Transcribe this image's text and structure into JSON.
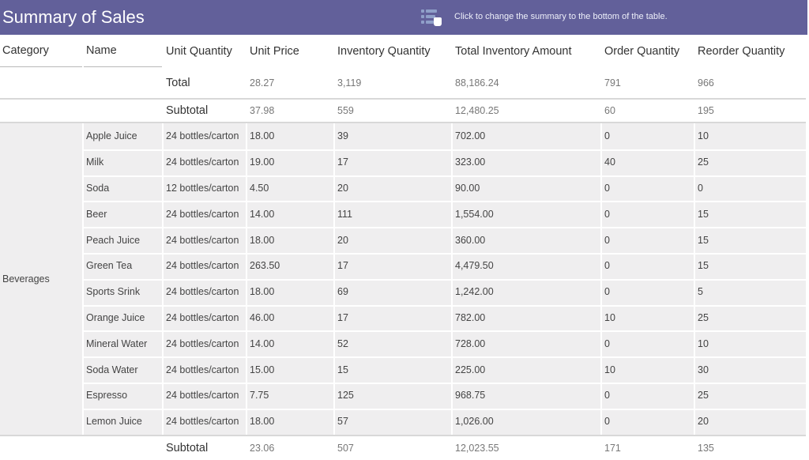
{
  "header": {
    "title": "Summary of Sales",
    "hint_icon": "summary-position-icon",
    "hint_text": "Click to change the summary to the bottom of the table."
  },
  "columns": [
    "Category",
    "Name",
    "Unit Quantity",
    "Unit Price",
    "Inventory Quantity",
    "Total Inventory Amount",
    "Order Quantity",
    "Reorder Quantity"
  ],
  "total": {
    "label": "Total",
    "unit_price": "28.27",
    "inventory_quantity": "3,119",
    "total_inventory_amount": "88,186.24",
    "order_quantity": "791",
    "reorder_quantity": "966"
  },
  "subtotal_top": {
    "label": "Subtotal",
    "unit_price": "37.98",
    "inventory_quantity": "559",
    "total_inventory_amount": "12,480.25",
    "order_quantity": "60",
    "reorder_quantity": "195"
  },
  "group": {
    "category": "Beverages",
    "rows": [
      {
        "name": "Apple Juice",
        "unit_quantity": "24 bottles/carton",
        "unit_price": "18.00",
        "inventory_quantity": "39",
        "total_inventory_amount": "702.00",
        "order_quantity": "0",
        "reorder_quantity": "10"
      },
      {
        "name": "Milk",
        "unit_quantity": "24 bottles/carton",
        "unit_price": "19.00",
        "inventory_quantity": "17",
        "total_inventory_amount": "323.00",
        "order_quantity": "40",
        "reorder_quantity": "25"
      },
      {
        "name": "Soda",
        "unit_quantity": "12 bottles/carton",
        "unit_price": "4.50",
        "inventory_quantity": "20",
        "total_inventory_amount": "90.00",
        "order_quantity": "0",
        "reorder_quantity": "0"
      },
      {
        "name": "Beer",
        "unit_quantity": "24 bottles/carton",
        "unit_price": "14.00",
        "inventory_quantity": "111",
        "total_inventory_amount": "1,554.00",
        "order_quantity": "0",
        "reorder_quantity": "15"
      },
      {
        "name": "Peach Juice",
        "unit_quantity": "24 bottles/carton",
        "unit_price": "18.00",
        "inventory_quantity": "20",
        "total_inventory_amount": "360.00",
        "order_quantity": "0",
        "reorder_quantity": "15"
      },
      {
        "name": "Green Tea",
        "unit_quantity": "24 bottles/carton",
        "unit_price": "263.50",
        "inventory_quantity": "17",
        "total_inventory_amount": "4,479.50",
        "order_quantity": "0",
        "reorder_quantity": "15"
      },
      {
        "name": "Sports Srink",
        "unit_quantity": "24 bottles/carton",
        "unit_price": "18.00",
        "inventory_quantity": "69",
        "total_inventory_amount": "1,242.00",
        "order_quantity": "0",
        "reorder_quantity": "5"
      },
      {
        "name": "Orange Juice",
        "unit_quantity": "24 bottles/carton",
        "unit_price": "46.00",
        "inventory_quantity": "17",
        "total_inventory_amount": "782.00",
        "order_quantity": "10",
        "reorder_quantity": "25"
      },
      {
        "name": "Mineral Water",
        "unit_quantity": "24 bottles/carton",
        "unit_price": "14.00",
        "inventory_quantity": "52",
        "total_inventory_amount": "728.00",
        "order_quantity": "0",
        "reorder_quantity": "10"
      },
      {
        "name": "Soda Water",
        "unit_quantity": "24 bottles/carton",
        "unit_price": "15.00",
        "inventory_quantity": "15",
        "total_inventory_amount": "225.00",
        "order_quantity": "10",
        "reorder_quantity": "30"
      },
      {
        "name": "Espresso",
        "unit_quantity": "24 bottles/carton",
        "unit_price": "7.75",
        "inventory_quantity": "125",
        "total_inventory_amount": "968.75",
        "order_quantity": "0",
        "reorder_quantity": "25"
      },
      {
        "name": "Lemon Juice",
        "unit_quantity": "24 bottles/carton",
        "unit_price": "18.00",
        "inventory_quantity": "57",
        "total_inventory_amount": "1,026.00",
        "order_quantity": "0",
        "reorder_quantity": "20"
      }
    ]
  },
  "subtotal_bottom": {
    "label": "Subtotal",
    "unit_price": "23.06",
    "inventory_quantity": "507",
    "total_inventory_amount": "12,023.55",
    "order_quantity": "171",
    "reorder_quantity": "135"
  },
  "colors": {
    "header_bg": "#62609a",
    "row_shade": "#efeeef"
  }
}
